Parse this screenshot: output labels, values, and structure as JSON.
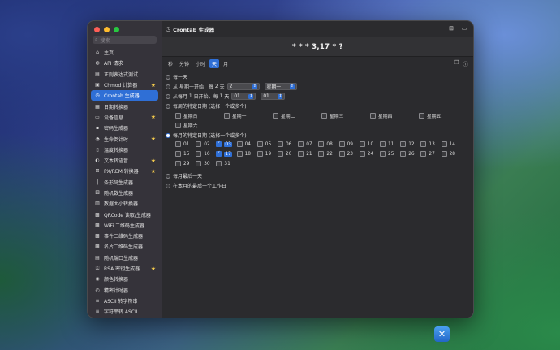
{
  "sidebar": {
    "search_placeholder": "搜索",
    "items": [
      {
        "label": "主页",
        "icon": "home-icon",
        "glyph": "⌂",
        "star": false
      },
      {
        "label": "API 请求",
        "icon": "globe-icon",
        "glyph": "◍",
        "star": false
      },
      {
        "label": "正则表达式测试",
        "icon": "regex-icon",
        "glyph": "▤",
        "star": false
      },
      {
        "label": "Chmod 计算器",
        "icon": "chmod-icon",
        "glyph": "▣",
        "star": true
      },
      {
        "label": "Crontab 生成器",
        "icon": "clock-icon",
        "glyph": "◷",
        "star": false,
        "selected": true
      },
      {
        "label": "日期转换器",
        "icon": "calendar-icon",
        "glyph": "▦",
        "star": false
      },
      {
        "label": "设备信息",
        "icon": "device-icon",
        "glyph": "▭",
        "star": true
      },
      {
        "label": "密码生成器",
        "icon": "password-icon",
        "glyph": "▪",
        "star": false
      },
      {
        "label": "生命倒计时",
        "icon": "timer-icon",
        "glyph": "◔",
        "star": true
      },
      {
        "label": "温度转换器",
        "icon": "thermometer-icon",
        "glyph": "▯",
        "star": false
      },
      {
        "label": "文本转语音",
        "icon": "speech-icon",
        "glyph": "◐",
        "star": true
      },
      {
        "label": "PX/REM 转换器",
        "icon": "ruler-icon",
        "glyph": "⊞",
        "star": true
      },
      {
        "label": "条形码生成器",
        "icon": "barcode-icon",
        "glyph": "║",
        "star": false
      },
      {
        "label": "随机数生成器",
        "icon": "dice-icon",
        "glyph": "⚄",
        "star": false
      },
      {
        "label": "数据大小转换器",
        "icon": "storage-icon",
        "glyph": "▥",
        "star": false
      },
      {
        "label": "QRCode 读取/生成器",
        "icon": "qrcode-icon",
        "glyph": "▩",
        "star": false
      },
      {
        "label": "WiFi 二维码生成器",
        "icon": "wifi-qrcode-icon",
        "glyph": "▩",
        "star": false
      },
      {
        "label": "事件二维码生成器",
        "icon": "event-qrcode-icon",
        "glyph": "▩",
        "star": false
      },
      {
        "label": "名片二维码生成器",
        "icon": "card-qrcode-icon",
        "glyph": "▩",
        "star": false
      },
      {
        "label": "随机端口生成器",
        "icon": "port-icon",
        "glyph": "▤",
        "star": false
      },
      {
        "label": "RSA 密钥生成器",
        "icon": "key-icon",
        "glyph": "⚿",
        "star": true
      },
      {
        "label": "颜色转换器",
        "icon": "palette-icon",
        "glyph": "◉",
        "star": false
      },
      {
        "label": "精密计时器",
        "icon": "stopwatch-icon",
        "glyph": "◴",
        "star": false
      },
      {
        "label": "ASCII 转字符串",
        "icon": "ascii-icon",
        "glyph": "≡",
        "star": false
      },
      {
        "label": "字符串转 ASCII",
        "icon": "string-icon",
        "glyph": "≡",
        "star": false
      }
    ]
  },
  "window": {
    "title": "Crontab 生成器"
  },
  "expression": "* * * 3,17 * ?",
  "tabs": [
    {
      "label": "秒",
      "selected": false
    },
    {
      "label": "分钟",
      "selected": false
    },
    {
      "label": "小时",
      "selected": false
    },
    {
      "label": "天",
      "selected": true
    },
    {
      "label": "月",
      "selected": false
    }
  ],
  "options": {
    "every_day": "每一天",
    "from_weekday_prefix": "从",
    "from_weekday_mid": "开始，每",
    "from_weekday_unit": "天",
    "weekday_start": "星期一",
    "weekday_interval": "2",
    "weekday_end": "星期一",
    "from_date_prefix": "从每月",
    "from_date_mid": "日开始，每",
    "from_date_unit": "天",
    "date_start": "01",
    "date_interval": "01",
    "specific_weekday": "每周的特定日期 (选择一个或多个)",
    "weekdays": [
      "星期日",
      "星期一",
      "星期二",
      "星期三",
      "星期四",
      "星期五",
      "星期六"
    ],
    "specific_day": "每月的特定日期 (选择一个或多个)",
    "days": [
      "01",
      "02",
      "03",
      "04",
      "05",
      "06",
      "07",
      "08",
      "09",
      "10",
      "11",
      "12",
      "13",
      "14",
      "15",
      "16",
      "17",
      "18",
      "19",
      "20",
      "21",
      "22",
      "23",
      "24",
      "25",
      "26",
      "27",
      "28",
      "29",
      "30",
      "31"
    ],
    "checked_days": [
      "03",
      "17"
    ],
    "last_day": "每月最后一天",
    "last_workday": "在本月的最后一个工作日"
  }
}
